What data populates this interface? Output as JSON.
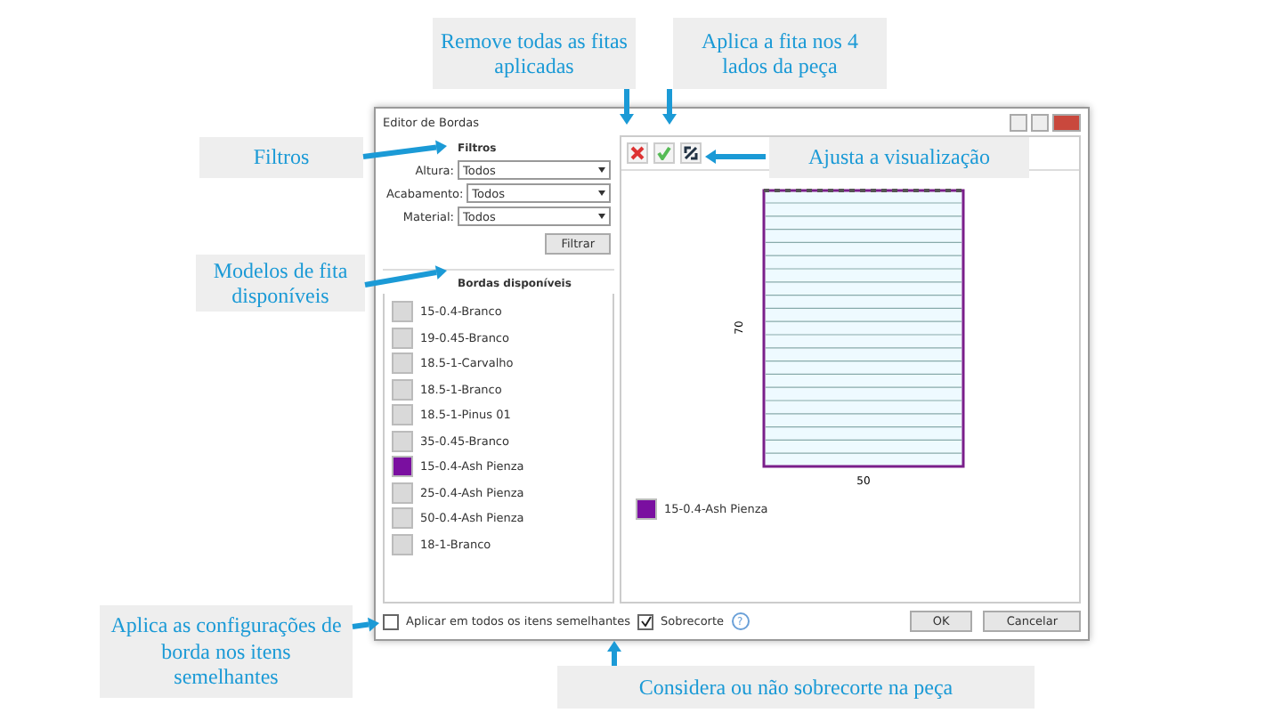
{
  "callouts": [
    "Remove todas as fitas aplicadas",
    "Aplica a fita nos 4 lados da peça",
    "Filtros",
    "Ajusta a visualização",
    "Modelos de fita disponíveis",
    "Aplica as configurações de borda nos itens semelhantes",
    "Considera ou não sobrecorte na peça"
  ],
  "window": {
    "title": "Editor de Bordas"
  },
  "filters": {
    "title": "Filtros",
    "fields": [
      {
        "label": "Altura:",
        "value": "Todos"
      },
      {
        "label": "Acabamento:",
        "value": "Todos"
      },
      {
        "label": "Material:",
        "value": "Todos"
      }
    ],
    "button": "Filtrar"
  },
  "tapes": {
    "title": "Bordas disponíveis",
    "items": [
      {
        "name": "15-0.4-Branco",
        "color": "#d9d9d9"
      },
      {
        "name": "19-0.45-Branco",
        "color": "#d9d9d9"
      },
      {
        "name": "18.5-1-Carvalho",
        "color": "#d9d9d9"
      },
      {
        "name": "18.5-1-Branco",
        "color": "#d9d9d9"
      },
      {
        "name": "18.5-1-Pinus 01",
        "color": "#d9d9d9"
      },
      {
        "name": "35-0.45-Branco",
        "color": "#d9d9d9"
      },
      {
        "name": "15-0.4-Ash Pienza",
        "color": "#7a0fa0"
      },
      {
        "name": "25-0.4-Ash Pienza",
        "color": "#d9d9d9"
      },
      {
        "name": "50-0.4-Ash Pienza",
        "color": "#d9d9d9"
      },
      {
        "name": "18-1-Branco",
        "color": "#d9d9d9"
      }
    ]
  },
  "preview": {
    "height_label": "70",
    "width_label": "50",
    "legend": {
      "name": "15-0.4-Ash Pienza",
      "color": "#7a0fa0"
    }
  },
  "footer": {
    "apply_all": {
      "label": "Aplicar em todos os itens semelhantes",
      "checked": false
    },
    "overcut": {
      "label": "Sobrecorte",
      "checked": true
    },
    "help": "?",
    "buttons": [
      "OK",
      "Cancelar"
    ]
  }
}
